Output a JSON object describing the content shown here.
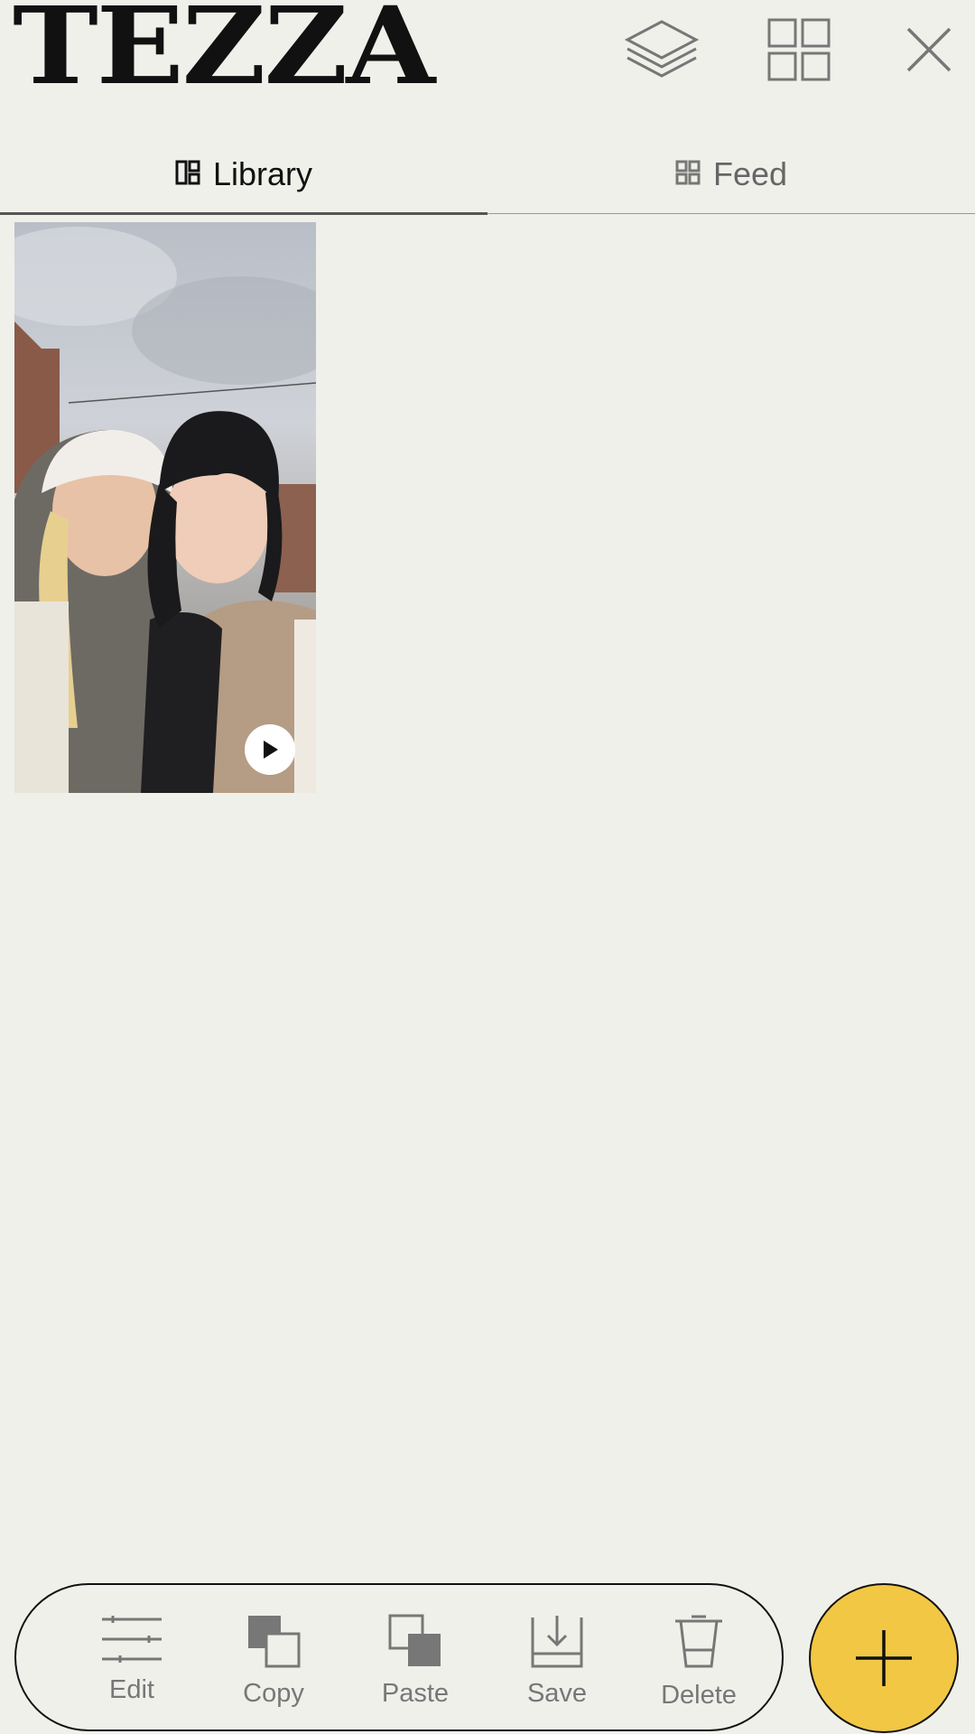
{
  "app": {
    "logo_text": "TEZZA"
  },
  "header": {
    "icons": [
      "layers-icon",
      "grid-icon",
      "close-icon"
    ]
  },
  "tabs": [
    {
      "label": "Library",
      "icon": "library-icon",
      "active": true
    },
    {
      "label": "Feed",
      "icon": "feed-grid-icon",
      "active": false
    }
  ],
  "library": {
    "items": [
      {
        "type": "video",
        "icon": "play-icon"
      }
    ]
  },
  "toolbar": {
    "edit": "Edit",
    "copy": "Copy",
    "paste": "Paste",
    "save": "Save",
    "delete": "Delete"
  },
  "fab": {
    "icon": "plus-icon"
  },
  "colors": {
    "background": "#EFF0EA",
    "fab": "#F2C744",
    "text": "#111111",
    "muted": "#777777"
  }
}
